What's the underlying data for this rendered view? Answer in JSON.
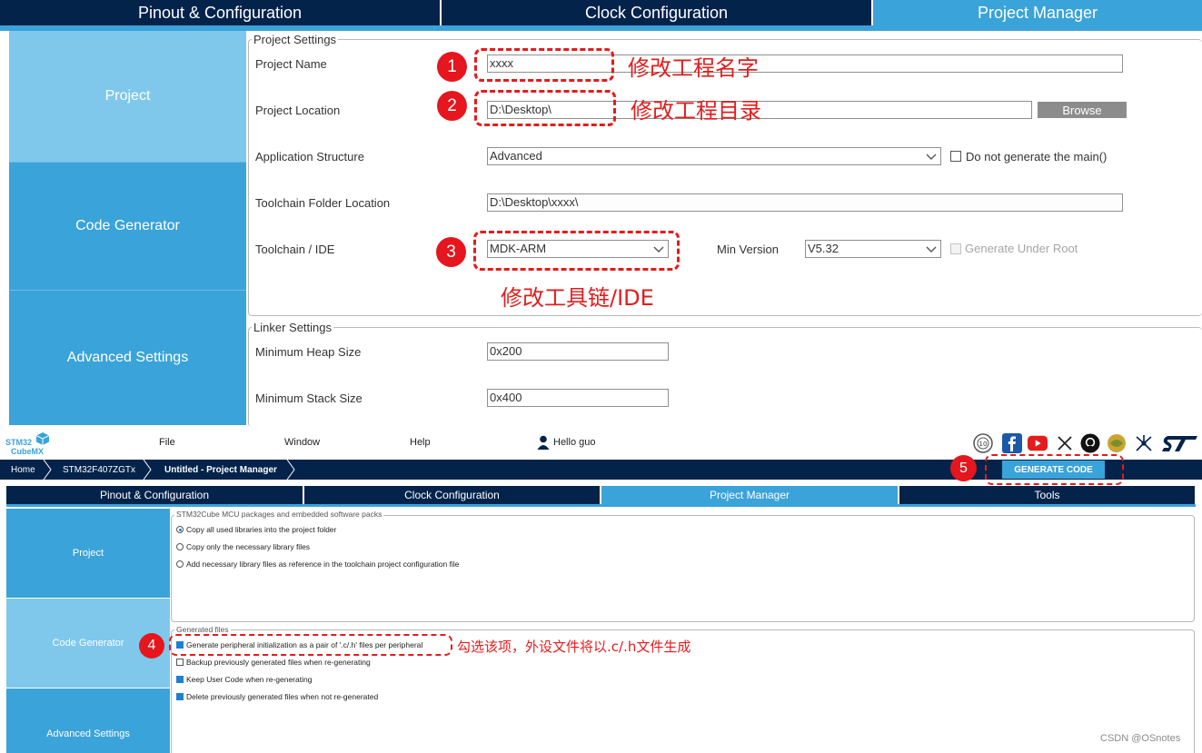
{
  "top": {
    "tabs": [
      "Pinout & Configuration",
      "Clock Configuration",
      "Project Manager"
    ],
    "sidebar": [
      "Project",
      "Code Generator",
      "Advanced Settings"
    ],
    "project_settings": {
      "legend": "Project Settings",
      "project_name_label": "Project Name",
      "project_name_value": "xxxx",
      "project_location_label": "Project Location",
      "project_location_value": "D:\\Desktop\\",
      "browse": "Browse",
      "app_structure_label": "Application Structure",
      "app_structure_value": "Advanced",
      "no_main_label": "Do not generate the main()",
      "toolchain_folder_label": "Toolchain Folder Location",
      "toolchain_folder_value": "D:\\Desktop\\xxxx\\",
      "toolchain_label": "Toolchain / IDE",
      "toolchain_value": "MDK-ARM",
      "min_version_label": "Min Version",
      "min_version_value": "V5.32",
      "gen_under_root": "Generate Under Root"
    },
    "linker_settings": {
      "legend": "Linker Settings",
      "heap_label": "Minimum Heap Size",
      "heap_value": "0x200",
      "stack_label": "Minimum Stack Size",
      "stack_value": "0x400"
    },
    "annotations": {
      "n1": "1",
      "t1": "修改工程名字",
      "n2": "2",
      "t2": "修改工程目录",
      "n3": "3",
      "t3": "修改工具链/IDE"
    }
  },
  "bottom": {
    "logo_top": "STM32",
    "logo_bottom": "CubeMX",
    "menu": [
      "File",
      "Window",
      "Help"
    ],
    "user": "Hello guo",
    "breadcrumbs": [
      "Home",
      "STM32F407ZGTx",
      "Untitled - Project Manager"
    ],
    "generate": "GENERATE CODE",
    "tabs": [
      "Pinout & Configuration",
      "Clock Configuration",
      "Project Manager",
      "Tools"
    ],
    "sidebar": [
      "Project",
      "Code Generator",
      "Advanced Settings"
    ],
    "packs": {
      "legend": "STM32Cube MCU packages and embedded software packs",
      "options": [
        "Copy all used libraries into the project folder",
        "Copy only the necessary library files",
        "Add necessary library files as reference in the toolchain project configuration file"
      ],
      "selected": 0
    },
    "generated": {
      "legend": "Generated files",
      "options": [
        "Generate peripheral initialization as a pair of '.c/.h' files per peripheral",
        "Backup previously generated files when re-generating",
        "Keep User Code when re-generating",
        "Delete previously generated files when not re-generated"
      ],
      "checked": [
        true,
        false,
        true,
        true
      ]
    },
    "annotations": {
      "n4": "4",
      "t4": "勾选该项，外设文件将以.c/.h文件生成",
      "n5": "5"
    },
    "watermark": "CSDN @OSnotes",
    "colors": {
      "navy": "#03234b",
      "accent": "#3aa3d9",
      "annotation": "#e31c1c"
    }
  }
}
